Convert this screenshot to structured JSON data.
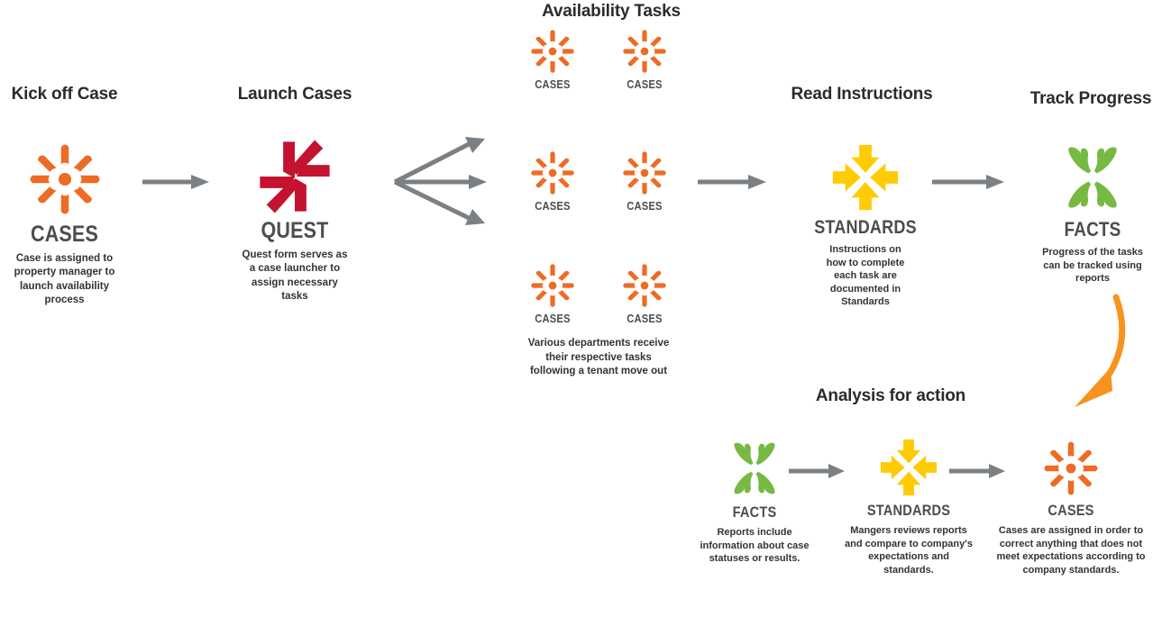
{
  "colors": {
    "cases_orange": "#EE6B24",
    "quest_red": "#C41230",
    "standards_yellow": "#FFCB05",
    "facts_green": "#76B943",
    "arrow_gray": "#7A8084",
    "curve_orange": "#F7941E",
    "label_gray": "#4D4D4D",
    "heading_dark": "#2B2B2B"
  },
  "phases": {
    "kick_off": "Kick off Case",
    "launch": "Launch Cases",
    "availability": "Availability Tasks",
    "read_instructions": "Read Instructions",
    "track_progress": "Track Progress",
    "analysis": "Analysis for action"
  },
  "nodes": {
    "cases_kickoff": {
      "label": "CASES",
      "icon": "cases-starburst-icon",
      "caption": "Case is assigned to property manager to launch availability process"
    },
    "quest_launch": {
      "label": "QUEST",
      "icon": "quest-pinwheel-icon",
      "caption": "Quest form serves as a case launcher to assign necessary tasks"
    },
    "tasks": [
      {
        "label": "CASES",
        "icon": "cases-starburst-icon"
      },
      {
        "label": "CASES",
        "icon": "cases-starburst-icon"
      },
      {
        "label": "CASES",
        "icon": "cases-starburst-icon"
      },
      {
        "label": "CASES",
        "icon": "cases-starburst-icon"
      },
      {
        "label": "CASES",
        "icon": "cases-starburst-icon"
      },
      {
        "label": "CASES",
        "icon": "cases-starburst-icon"
      }
    ],
    "tasks_caption": "Various departments receive their respective tasks following a tenant move out",
    "standards_instructions": {
      "label": "STANDARDS",
      "icon": "standards-arrows-icon",
      "caption": "Instructions on how to complete each task are documented in Standards"
    },
    "facts_track": {
      "label": "FACTS",
      "icon": "facts-petals-icon",
      "caption": "Progress of the tasks can be tracked using reports"
    },
    "facts_reports": {
      "label": "FACTS",
      "icon": "facts-petals-icon",
      "caption": "Reports include information about case statuses or results."
    },
    "standards_review": {
      "label": "STANDARDS",
      "icon": "standards-arrows-icon",
      "caption": "Mangers reviews reports and compare to company's expectations and standards."
    },
    "cases_corrective": {
      "label": "CASES",
      "icon": "cases-starburst-icon",
      "caption": "Cases are assigned in order to correct anything that does not meet expectations according to company standards."
    }
  },
  "arrows": {
    "kickoff_to_quest": "arrow-right-gray",
    "quest_branch": "arrow-branch-three-gray",
    "tasks_to_standards": "arrow-right-gray",
    "standards_to_facts": "arrow-right-gray",
    "facts_to_analysis": "arrow-curved-orange",
    "facts_to_standards_bottom": "arrow-right-gray",
    "standards_to_cases_bottom": "arrow-right-gray"
  }
}
